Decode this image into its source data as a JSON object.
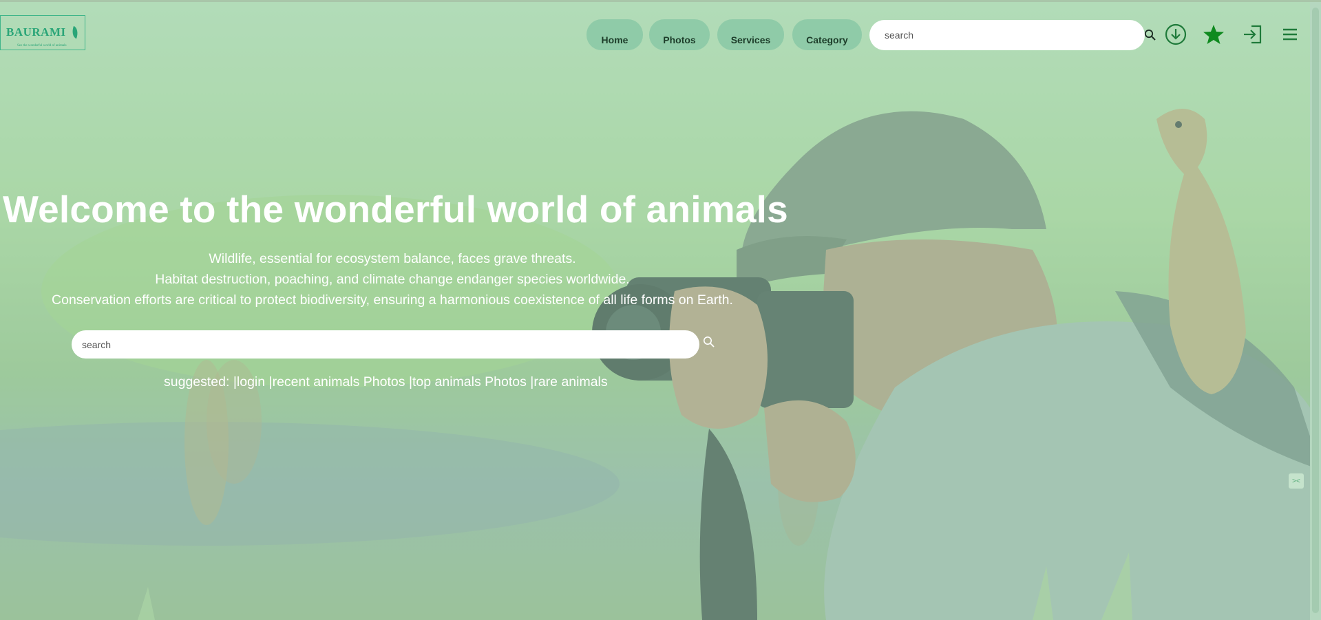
{
  "brand": {
    "logo_text": "BAURAMI",
    "tagline": "See the wonderful world of animals"
  },
  "nav": {
    "items": [
      {
        "label": "Home"
      },
      {
        "label": "Photos"
      },
      {
        "label": "Services"
      },
      {
        "label": "Category"
      }
    ],
    "search_placeholder": "search"
  },
  "header_icons": {
    "search": "search-icon",
    "download": "download-icon",
    "favorite": "star-icon",
    "login": "login-icon",
    "menu": "menu-icon"
  },
  "hero": {
    "title": "Welcome to the wonderful world of animals",
    "line1": "Wildlife, essential for ecosystem balance, faces grave threats.",
    "line2": "Habitat destruction, poaching, and climate change endanger species worldwide.",
    "line3": "Conservation efforts are critical to protect biodiversity, ensuring a harmonious coexistence of all life forms on Earth.",
    "search_placeholder": "search",
    "suggested_label": "suggested: ",
    "suggestions": [
      "|login ",
      "|recent animals Photos ",
      "|top animals Photos ",
      "|rare animals"
    ]
  },
  "colors": {
    "accent": "#2aa578",
    "nav_button": "#8fcba8",
    "star": "#0f8a1f",
    "icon": "#1f7a3a"
  }
}
